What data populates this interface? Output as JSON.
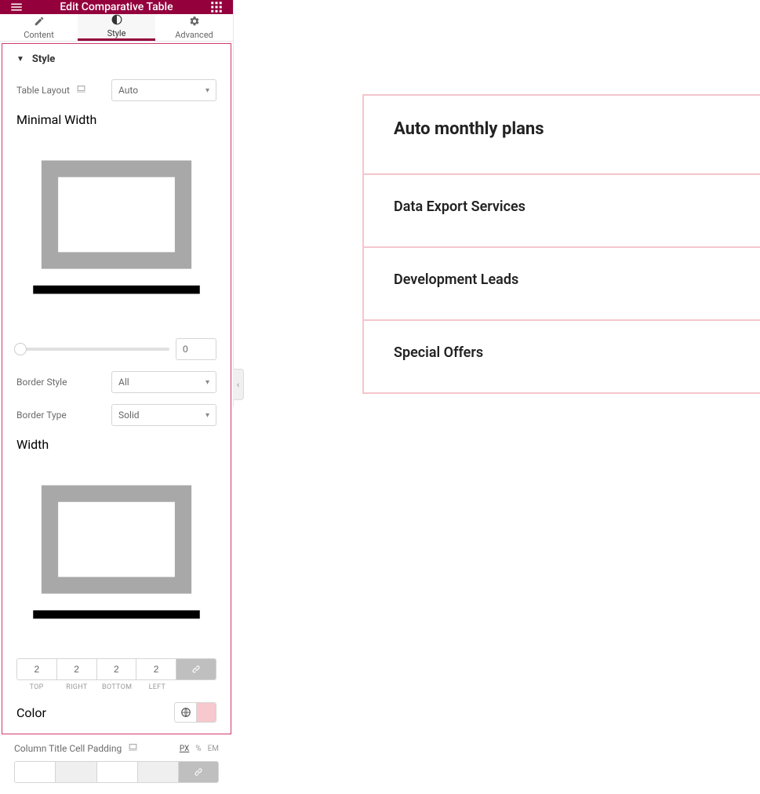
{
  "header": {
    "title": "Edit Comparative Table"
  },
  "tabs": {
    "content": "Content",
    "style": "Style",
    "advanced": "Advanced"
  },
  "section": {
    "title": "Style"
  },
  "controls": {
    "tableLayout": {
      "label": "Table Layout",
      "value": "Auto"
    },
    "minimalWidth": {
      "label": "Minimal Width",
      "value": "0"
    },
    "borderStyle": {
      "label": "Border Style",
      "value": "All"
    },
    "borderType": {
      "label": "Border Type",
      "value": "Solid"
    },
    "width": {
      "label": "Width",
      "top": "2",
      "right": "2",
      "bottom": "2",
      "left": "2",
      "labels": {
        "top": "TOP",
        "right": "RIGHT",
        "bottom": "BOTTOM",
        "left": "LEFT"
      }
    },
    "color": {
      "label": "Color",
      "value": "#f7c8cd"
    },
    "cellPadding": {
      "label": "Column Title Cell Padding",
      "units": {
        "px": "PX",
        "pct": "%",
        "em": "EM"
      }
    }
  },
  "preview": {
    "rows": [
      "Auto monthly plans",
      "Data Export Services",
      "Development Leads",
      "Special Offers"
    ]
  }
}
